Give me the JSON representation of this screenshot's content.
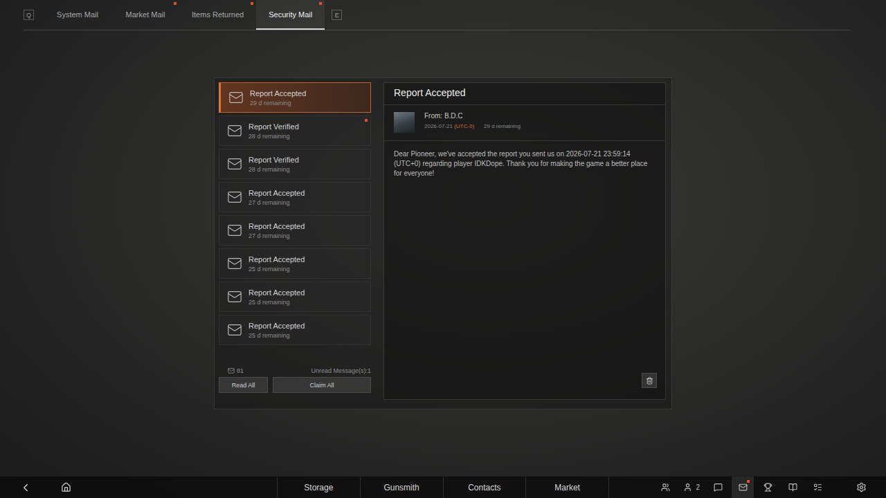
{
  "keys": {
    "prev": "Q",
    "next": "E"
  },
  "tabs": [
    {
      "label": "System Mail",
      "selected": false,
      "unread": false
    },
    {
      "label": "Market Mail",
      "selected": false,
      "unread": true
    },
    {
      "label": "Items Returned",
      "selected": false,
      "unread": true
    },
    {
      "label": "Security Mail",
      "selected": true,
      "unread": true
    }
  ],
  "mail_list": {
    "items": [
      {
        "title": "Report Accepted",
        "remaining": "29 d remaining",
        "selected": true,
        "unread": false
      },
      {
        "title": "Report Verified",
        "remaining": "28 d remaining",
        "selected": false,
        "unread": true
      },
      {
        "title": "Report Verified",
        "remaining": "28 d remaining",
        "selected": false,
        "unread": false
      },
      {
        "title": "Report Accepted",
        "remaining": "27 d remaining",
        "selected": false,
        "unread": false
      },
      {
        "title": "Report Accepted",
        "remaining": "27 d remaining",
        "selected": false,
        "unread": false
      },
      {
        "title": "Report Accepted",
        "remaining": "25 d remaining",
        "selected": false,
        "unread": false
      },
      {
        "title": "Report Accepted",
        "remaining": "25 d remaining",
        "selected": false,
        "unread": false
      },
      {
        "title": "Report Accepted",
        "remaining": "25 d remaining",
        "selected": false,
        "unread": false
      }
    ],
    "count": "81",
    "unread": "Unread Message(s):1",
    "buttons": [
      "Read All",
      "Claim All"
    ]
  },
  "detail": {
    "title": "Report Accepted",
    "from": "From: B.D.C",
    "date": "2026-07-21",
    "timezone": "(UTC-0)",
    "remaining": "29 d remaining",
    "body": "Dear Pioneer, we've accepted the report you sent us on 2026-07-21 23:59:14 (UTC+0) regarding player IDKDope. Thank you for making the game a better place for everyone!"
  },
  "nav": {
    "items": [
      "Storage",
      "Gunsmith",
      "Contacts",
      "Market"
    ],
    "tray": [
      {
        "kind": "squad",
        "badge": "",
        "alert": false,
        "active": false
      },
      {
        "kind": "friends",
        "badge": "2",
        "alert": false,
        "active": false
      },
      {
        "kind": "chat",
        "badge": "",
        "alert": false,
        "active": false
      },
      {
        "kind": "mail",
        "badge": "",
        "alert": true,
        "active": true
      },
      {
        "kind": "achievements",
        "badge": "",
        "alert": false,
        "active": false
      },
      {
        "kind": "codex",
        "badge": "",
        "alert": false,
        "active": false
      },
      {
        "kind": "tasks",
        "badge": "",
        "alert": false,
        "active": false
      }
    ]
  }
}
